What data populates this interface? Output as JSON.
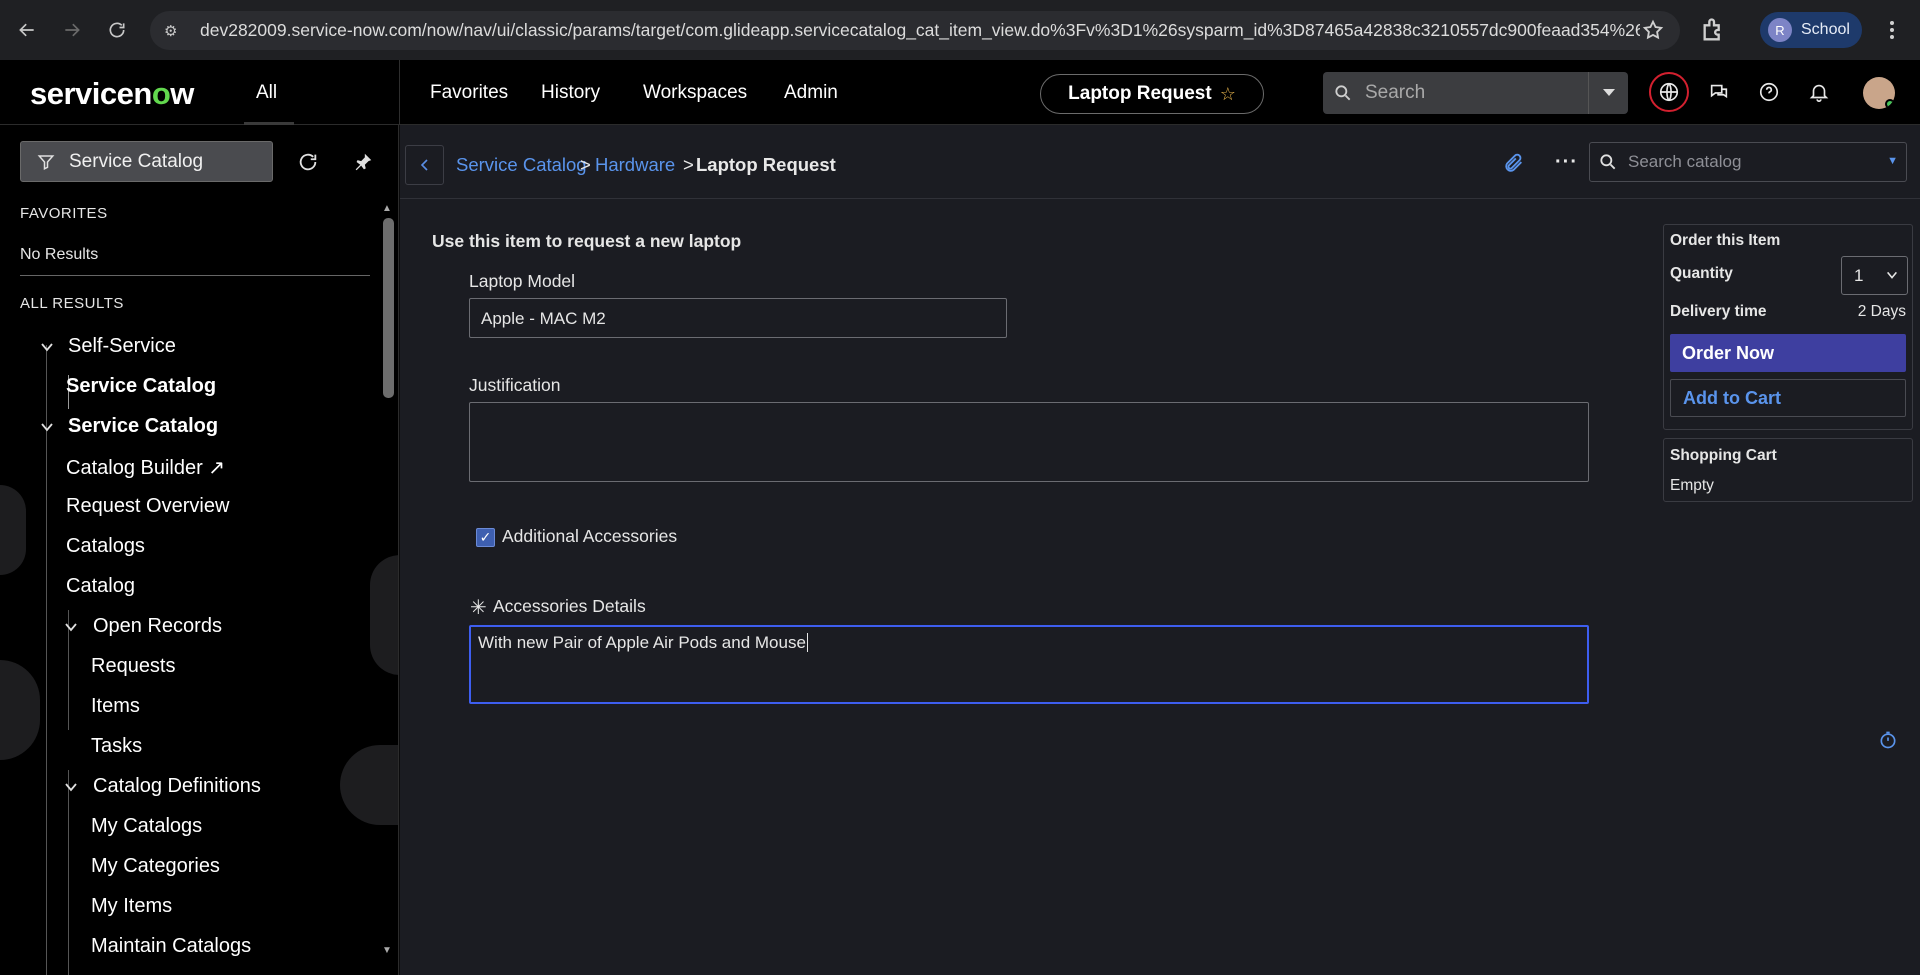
{
  "browser": {
    "url": "dev282009.service-now.com/now/nav/ui/classic/params/target/com.glideapp.servicecatalog_cat_item_view.do%3Fv%3D1%26sysparm_id%3D87465a42838c3210557dc900feaad354%26...",
    "profile_initial": "R",
    "profile_label": "School"
  },
  "header": {
    "logo": "servicenow",
    "all_label": "All",
    "menu": [
      "Favorites",
      "History",
      "Workspaces",
      "Admin"
    ],
    "context_pill": "Laptop Request",
    "search_placeholder": "Search"
  },
  "sidebar": {
    "filter_value": "Service Catalog",
    "favorites_label": "FAVORITES",
    "favorites_empty": "No Results",
    "all_results_label": "ALL RESULTS",
    "items": [
      {
        "label": "Self-Service",
        "level": 0,
        "expandable": true,
        "bold": false
      },
      {
        "label": "Service Catalog",
        "level": 1,
        "expandable": false,
        "bold": true
      },
      {
        "label": "Service Catalog",
        "level": 0,
        "expandable": true,
        "bold": true
      },
      {
        "label": "Catalog Builder ↗",
        "level": 1,
        "expandable": false,
        "bold": false
      },
      {
        "label": "Request Overview",
        "level": 1,
        "expandable": false,
        "bold": false
      },
      {
        "label": "Catalogs",
        "level": 1,
        "expandable": false,
        "bold": false
      },
      {
        "label": "Catalog",
        "level": 1,
        "expandable": false,
        "bold": false
      },
      {
        "label": "Open Records",
        "level": 1,
        "expandable": true,
        "bold": false
      },
      {
        "label": "Requests",
        "level": 2,
        "expandable": false,
        "bold": false
      },
      {
        "label": "Items",
        "level": 2,
        "expandable": false,
        "bold": false
      },
      {
        "label": "Tasks",
        "level": 2,
        "expandable": false,
        "bold": false
      },
      {
        "label": "Catalog Definitions",
        "level": 1,
        "expandable": true,
        "bold": false
      },
      {
        "label": "My Catalogs",
        "level": 2,
        "expandable": false,
        "bold": false
      },
      {
        "label": "My Categories",
        "level": 2,
        "expandable": false,
        "bold": false
      },
      {
        "label": "My Items",
        "level": 2,
        "expandable": false,
        "bold": false
      },
      {
        "label": "Maintain Catalogs",
        "level": 2,
        "expandable": false,
        "bold": false
      }
    ]
  },
  "breadcrumb": {
    "items": [
      "Service Catalog",
      "Hardware",
      "Laptop Request"
    ],
    "separator": ">"
  },
  "catalog_search": {
    "placeholder": "Search catalog"
  },
  "form": {
    "intro": "Use this item to request a new laptop",
    "laptop_model_label": "Laptop Model",
    "laptop_model_value": "Apple - MAC M2",
    "justification_label": "Justification",
    "justification_value": "",
    "accessories_checkbox_label": "Additional Accessories",
    "accessories_checked": true,
    "accessories_details_label": "Accessories Details",
    "accessories_details_required_mark": "✳",
    "accessories_details_value": "With new Pair of Apple Air Pods and Mouse"
  },
  "order_panel": {
    "title": "Order this Item",
    "quantity_label": "Quantity",
    "quantity_value": "1",
    "delivery_label": "Delivery time",
    "delivery_value": "2 Days",
    "order_now": "Order Now",
    "add_to_cart": "Add to Cart"
  },
  "cart_panel": {
    "title": "Shopping Cart",
    "status": "Empty"
  },
  "colors": {
    "accent_blue": "#5a94ec",
    "order_button": "#3e3fa0",
    "focus_border": "#3e5ef0",
    "logo_green": "#62d84e"
  }
}
